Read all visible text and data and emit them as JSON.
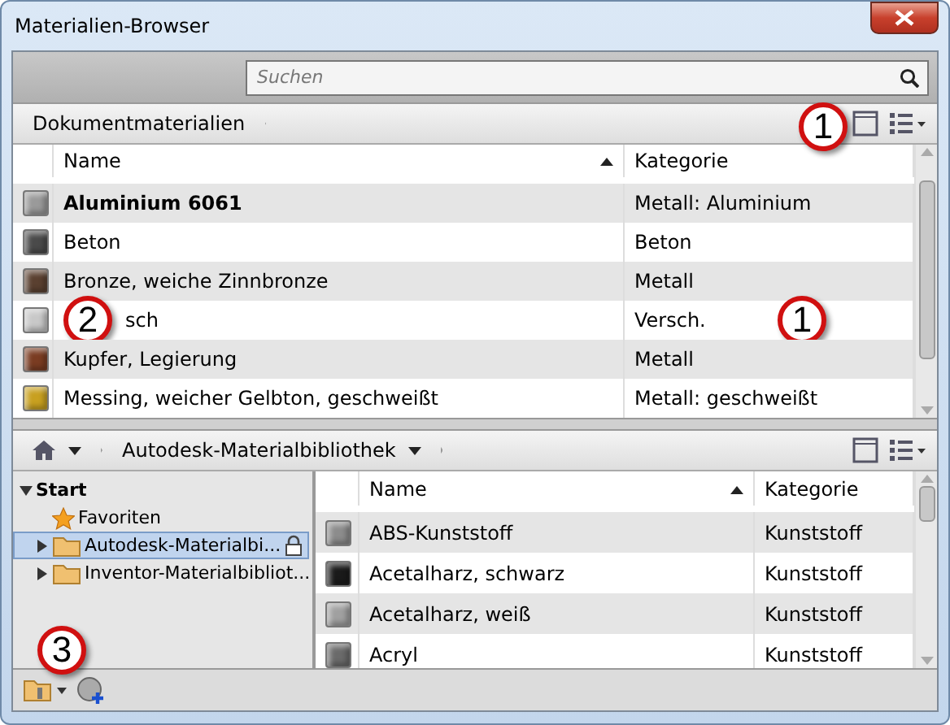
{
  "window": {
    "title": "Materialien-Browser"
  },
  "search": {
    "placeholder": "Suchen"
  },
  "document_materials": {
    "breadcrumb": "Dokumentmaterialien",
    "columns": [
      {
        "label": "Name",
        "sorted": true
      },
      {
        "label": "Kategorie",
        "sorted": false
      }
    ],
    "rows": [
      {
        "name": "Aluminium 6061",
        "category": "Metall: Aluminium",
        "color": "#9a9a9a",
        "active": true
      },
      {
        "name": "Beton",
        "category": "Beton",
        "color": "#4a4a4a",
        "active": false
      },
      {
        "name": "Bronze, weiche Zinnbronze",
        "category": "Metall",
        "color": "#5a4030",
        "active": false
      },
      {
        "name": "sch",
        "category": "Versch.",
        "color": "#c8c8c8",
        "active": false,
        "name_callout": "2",
        "category_callout": "1"
      },
      {
        "name": "Kupfer, Legierung",
        "category": "Metall",
        "color": "#7a3c22",
        "active": false
      },
      {
        "name": "Messing, weicher Gelbton, geschweißt",
        "category": "Metall: geschweißt",
        "color": "#c8a020",
        "active": false
      }
    ]
  },
  "library": {
    "breadcrumb": "Autodesk-Materialbibliothek",
    "tree": [
      {
        "label": "Start",
        "expanded": true,
        "selected": false,
        "children": [
          {
            "label": "Favoriten",
            "kind": "favorites",
            "selected": false
          },
          {
            "label": "Autodesk-Materialbi...",
            "kind": "folder",
            "expanded": false,
            "locked": true,
            "selected": true
          },
          {
            "label": "Inventor-Materialbibliot...",
            "kind": "folder",
            "expanded": false,
            "locked": false,
            "selected": false
          }
        ]
      }
    ],
    "columns": [
      {
        "label": "Name",
        "sorted": true
      },
      {
        "label": "Kategorie",
        "sorted": false
      }
    ],
    "rows": [
      {
        "name": "ABS-Kunststoff",
        "category": "Kunststoff",
        "color": "#8c8c8c"
      },
      {
        "name": "Acetalharz, schwarz",
        "category": "Kunststoff",
        "color": "#1a1a1a"
      },
      {
        "name": "Acetalharz, weiß",
        "category": "Kunststoff",
        "color": "#a0a0a0"
      },
      {
        "name": "Acryl",
        "category": "Kunststoff",
        "color": "#6a6a6a"
      }
    ]
  },
  "callouts": [
    {
      "label": "1"
    },
    {
      "label": "3"
    }
  ]
}
